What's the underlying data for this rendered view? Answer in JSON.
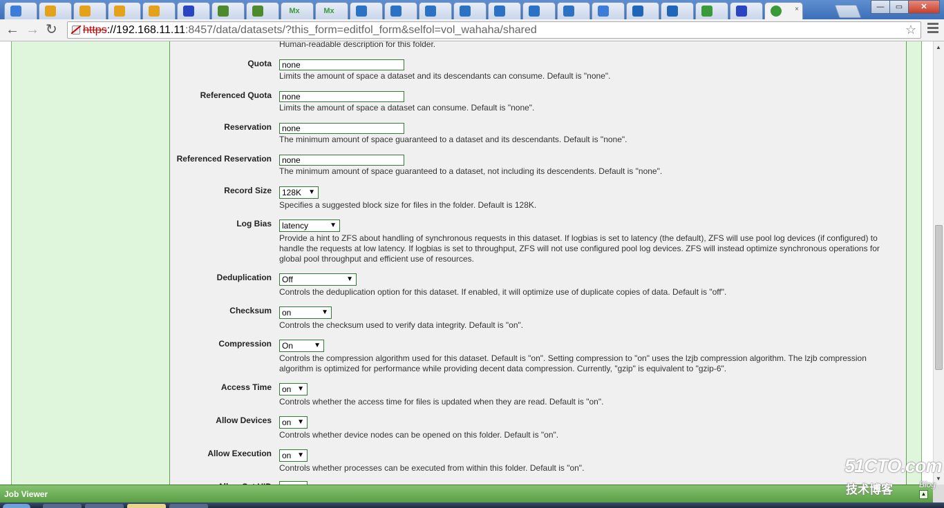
{
  "tabs": [
    {
      "icon": "app-icon",
      "color": "#3b7dd8"
    },
    {
      "icon": "owl-icon",
      "color": "#e3a21a"
    },
    {
      "icon": "owl-icon",
      "color": "#e3a21a"
    },
    {
      "icon": "owl-icon",
      "color": "#e3a21a"
    },
    {
      "icon": "owl-icon",
      "color": "#e3a21a"
    },
    {
      "icon": "paw-icon",
      "color": "#2a45c2"
    },
    {
      "icon": "book-icon",
      "color": "#4d8a2e"
    },
    {
      "icon": "book-icon",
      "color": "#4d8a2e"
    },
    {
      "icon": "mx-icon",
      "color": "#3a9a3a",
      "label": "Mx"
    },
    {
      "icon": "mx-icon",
      "color": "#3a9a3a",
      "label": "Mx"
    },
    {
      "icon": "play-icon",
      "color": "#2b72c4"
    },
    {
      "icon": "play-icon",
      "color": "#2b72c4"
    },
    {
      "icon": "play-icon",
      "color": "#2b72c4"
    },
    {
      "icon": "play-icon",
      "color": "#2b72c4"
    },
    {
      "icon": "play-icon",
      "color": "#2b72c4"
    },
    {
      "icon": "play-icon",
      "color": "#2b72c4"
    },
    {
      "icon": "play-icon",
      "color": "#2b72c4"
    },
    {
      "icon": "app-icon",
      "color": "#3b7dd8"
    },
    {
      "icon": "home-icon",
      "color": "#1f66b8"
    },
    {
      "icon": "refresh-icon",
      "color": "#1f66b8"
    },
    {
      "icon": "leaf-icon",
      "color": "#3a9a3a"
    },
    {
      "icon": "paw-icon",
      "color": "#2a45c2"
    }
  ],
  "active_tab": {
    "icon": "leaf-icon",
    "color": "#3a9a3a",
    "close": "×"
  },
  "window_controls": {
    "minimize": "—",
    "maximize": "▭",
    "close": "✕"
  },
  "toolbar": {
    "back": "←",
    "forward": "→",
    "reload": "↻",
    "url_proto": "https",
    "url_host": "://192.168.11.11",
    "url_rest": ":8457/data/datasets/?this_form=editfol_form&selfol=vol_wahaha/shared",
    "star": "☆"
  },
  "form": {
    "top_help": "Human-readable description for this folder.",
    "fields": [
      {
        "label": "Quota",
        "type": "text",
        "value": "none",
        "help": "Limits the amount of space a dataset and its descendants can consume. Default is \"none\"."
      },
      {
        "label": "Referenced Quota",
        "type": "text",
        "value": "none",
        "help": "Limits the amount of space a dataset can consume. Default is \"none\"."
      },
      {
        "label": "Reservation",
        "type": "text",
        "value": "none",
        "help": "The minimum amount of space guaranteed to a dataset and its descendants. Default is \"none\"."
      },
      {
        "label": "Referenced Reservation",
        "type": "text",
        "value": "none",
        "help": "The minimum amount of space guaranteed to a dataset, not including its descendents. Default is \"none\"."
      },
      {
        "label": "Record Size",
        "type": "select",
        "value": "128K",
        "help": "Specifies a suggested block size for files in the folder. Default is 128K."
      },
      {
        "label": "Log Bias",
        "type": "select",
        "value": "latency",
        "help": "Provide a hint to ZFS about handling of synchronous requests in this dataset. If logbias is set to latency (the default), ZFS will use pool log devices (if configured) to handle the requests at low latency. If logbias is set to throughput, ZFS will not use configured pool log devices. ZFS will instead optimize synchronous operations for global pool throughput and efficient use of resources."
      },
      {
        "label": "Deduplication",
        "type": "select",
        "value": "Off",
        "help": "Controls the deduplication option for this dataset. If enabled, it will optimize use of duplicate copies of data. Default is \"off\"."
      },
      {
        "label": "Checksum",
        "type": "select",
        "value": "on",
        "help": "Controls the checksum used to verify data integrity. Default is \"on\"."
      },
      {
        "label": "Compression",
        "type": "select",
        "value": "On",
        "help": "Controls the compression algorithm used for this dataset. Default is \"on\". Setting compression to \"on\" uses the lzjb compression algorithm. The lzjb compression algorithm is optimized for performance while providing decent data compression. Currently, \"gzip\" is equivalent to \"gzip-6\"."
      },
      {
        "label": "Access Time",
        "type": "select",
        "value": "on",
        "help": "Controls whether the access time for files is updated when they are read. Default is \"on\"."
      },
      {
        "label": "Allow Devices",
        "type": "select",
        "value": "on",
        "help": "Controls whether device nodes can be opened on this folder. Default is \"on\"."
      },
      {
        "label": "Allow Execution",
        "type": "select",
        "value": "on",
        "help": "Controls whether processes can be executed from within this folder. Default is \"on\"."
      }
    ],
    "partial_label": "Allow Set UID"
  },
  "job_viewer": {
    "title": "Job Viewer",
    "toggle": "▲"
  },
  "watermark": {
    "line1": "51CTO.com",
    "line2": "技术博客",
    "line3": "Blog"
  },
  "colors": {
    "panel_green": "#dff5dc",
    "border_green": "#5ba34f",
    "jobviewer": "#6aae52"
  }
}
